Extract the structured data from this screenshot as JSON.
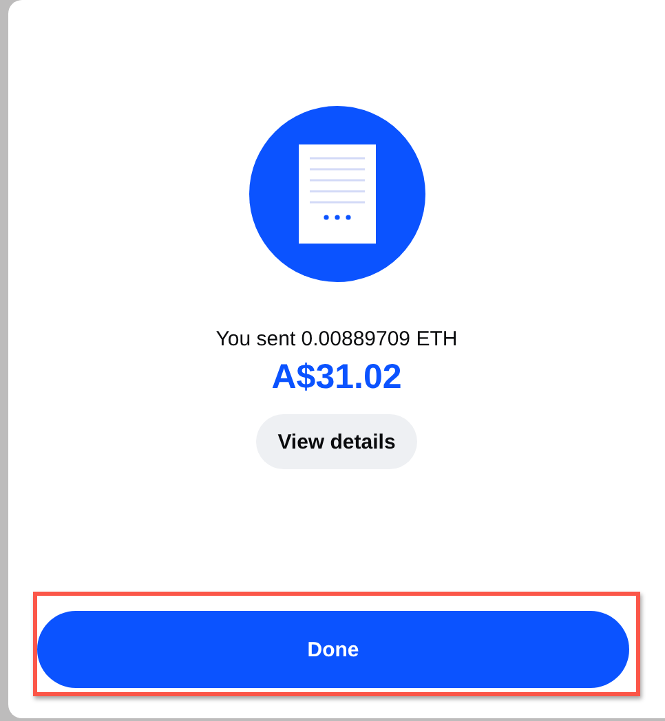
{
  "modal": {
    "message": "You sent 0.00889709 ETH",
    "amount": "A$31.02"
  },
  "buttons": [
    {
      "label": "View details",
      "kind": "secondary",
      "highlighted": false
    },
    {
      "label": "Done",
      "kind": "primary",
      "highlighted": true
    }
  ]
}
